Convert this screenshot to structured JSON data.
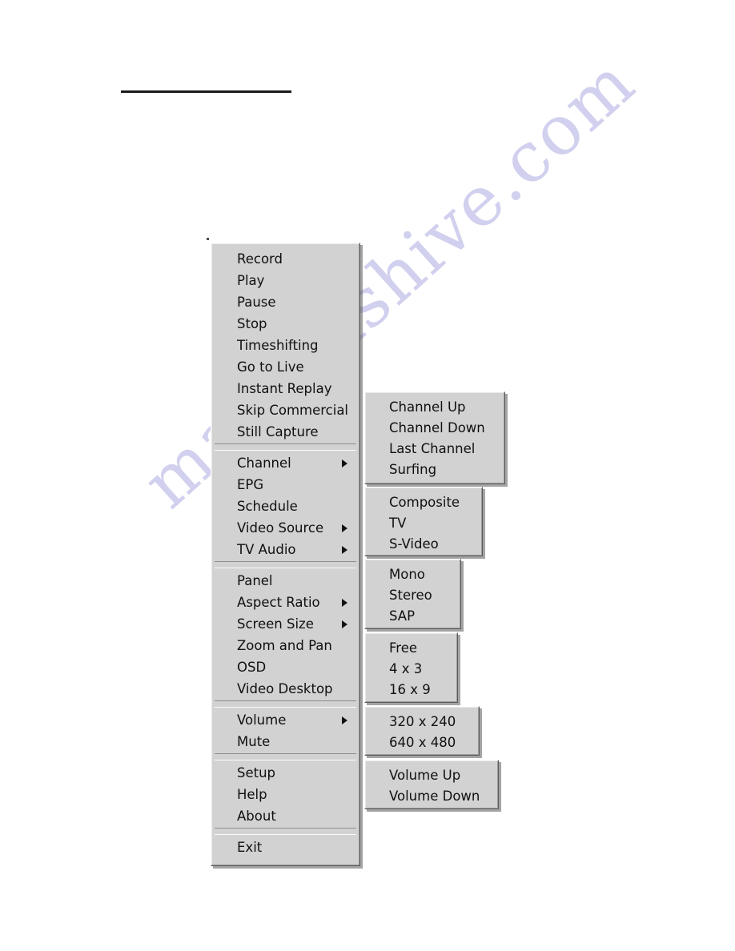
{
  "page": {
    "background_color": "#ffffff",
    "watermark_text": "manualshive.com",
    "watermark_color": "#c9c8ec",
    "rule_color": "#1b1b1b"
  },
  "menu_style": {
    "face_color": "#d2d2d2",
    "text_color": "#101010",
    "highlight_color": "#ffffff",
    "shadow_color": "#5c5c5c"
  },
  "main_menu": {
    "name": "main-context-menu",
    "groups": [
      {
        "items": [
          {
            "label": "Record",
            "has_submenu": false
          },
          {
            "label": "Play",
            "has_submenu": false
          },
          {
            "label": "Pause",
            "has_submenu": false
          },
          {
            "label": "Stop",
            "has_submenu": false
          },
          {
            "label": "Timeshifting",
            "has_submenu": false
          },
          {
            "label": "Go to Live",
            "has_submenu": false
          },
          {
            "label": "Instant Replay",
            "has_submenu": false
          },
          {
            "label": "Skip Commercial",
            "has_submenu": false
          },
          {
            "label": "Still Capture",
            "has_submenu": false
          }
        ]
      },
      {
        "items": [
          {
            "label": "Channel",
            "has_submenu": true
          },
          {
            "label": "EPG",
            "has_submenu": false
          },
          {
            "label": "Schedule",
            "has_submenu": false
          },
          {
            "label": "Video Source",
            "has_submenu": true
          },
          {
            "label": "TV Audio",
            "has_submenu": true
          }
        ]
      },
      {
        "items": [
          {
            "label": "Panel",
            "has_submenu": false
          },
          {
            "label": "Aspect Ratio",
            "has_submenu": true
          },
          {
            "label": "Screen Size",
            "has_submenu": true
          },
          {
            "label": "Zoom and Pan",
            "has_submenu": false
          },
          {
            "label": "OSD",
            "has_submenu": false
          },
          {
            "label": "Video Desktop",
            "has_submenu": false
          }
        ]
      },
      {
        "items": [
          {
            "label": "Volume",
            "has_submenu": true
          },
          {
            "label": "Mute",
            "has_submenu": false
          }
        ]
      },
      {
        "items": [
          {
            "label": "Setup",
            "has_submenu": false
          },
          {
            "label": "Help",
            "has_submenu": false
          },
          {
            "label": "About",
            "has_submenu": false
          }
        ]
      },
      {
        "items": [
          {
            "label": "Exit",
            "has_submenu": false
          }
        ]
      }
    ]
  },
  "submenus": {
    "channel": {
      "parent": "Channel",
      "items": [
        {
          "label": "Channel Up"
        },
        {
          "label": "Channel Down"
        },
        {
          "label": "Last Channel"
        },
        {
          "label": "Surfing"
        }
      ]
    },
    "video_source": {
      "parent": "Video Source",
      "items": [
        {
          "label": "Composite"
        },
        {
          "label": "TV"
        },
        {
          "label": "S-Video"
        }
      ]
    },
    "tv_audio": {
      "parent": "TV Audio",
      "items": [
        {
          "label": "Mono"
        },
        {
          "label": "Stereo"
        },
        {
          "label": "SAP"
        }
      ]
    },
    "aspect_ratio": {
      "parent": "Aspect Ratio",
      "items": [
        {
          "label": "Free"
        },
        {
          "label": "4 x 3"
        },
        {
          "label": "16 x 9"
        }
      ]
    },
    "screen_size": {
      "parent": "Screen Size",
      "items": [
        {
          "label": "320 x 240"
        },
        {
          "label": "640 x 480"
        }
      ]
    },
    "volume": {
      "parent": "Volume",
      "items": [
        {
          "label": "Volume Up"
        },
        {
          "label": "Volume Down"
        }
      ]
    }
  }
}
